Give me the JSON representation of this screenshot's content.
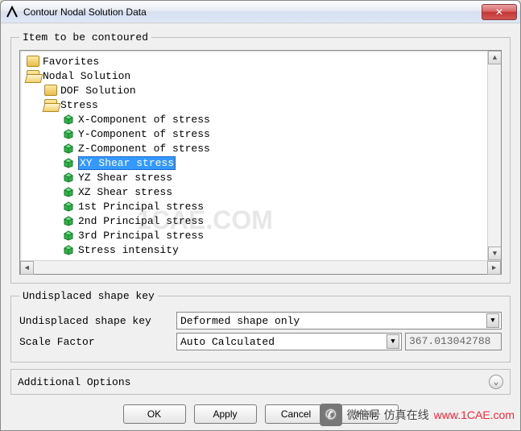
{
  "window": {
    "title": "Contour Nodal Solution Data",
    "close_glyph": "✕"
  },
  "group_tree_legend": "Item to be contoured",
  "tree": {
    "favorites": "Favorites",
    "nodal_solution": "Nodal Solution",
    "dof_solution": "DOF Solution",
    "stress": "Stress",
    "items": {
      "x_comp": "X-Component of stress",
      "y_comp": "Y-Component of stress",
      "z_comp": "Z-Component of stress",
      "xy_shear": "XY Shear stress",
      "yz_shear": "YZ Shear stress",
      "xz_shear": "XZ Shear stress",
      "p1": "1st Principal stress",
      "p2": "2nd Principal stress",
      "p3": "3rd Principal stress",
      "intensity": "Stress intensity"
    }
  },
  "shape_group_legend": "Undisplaced shape key",
  "shape_key": {
    "label": "Undisplaced shape key",
    "value": "Deformed shape only"
  },
  "scale_factor": {
    "label": "Scale Factor",
    "value": "Auto Calculated",
    "readonly": "367.013042788"
  },
  "additional_options": "Additional Options",
  "buttons": {
    "ok": "OK",
    "apply": "Apply",
    "cancel": "Cancel",
    "help": "Help"
  },
  "watermarks": {
    "mid": "1CAE.COM",
    "bottom_url": "www.1CAE.com",
    "bottom_cn": "微信号 仿真在线"
  }
}
